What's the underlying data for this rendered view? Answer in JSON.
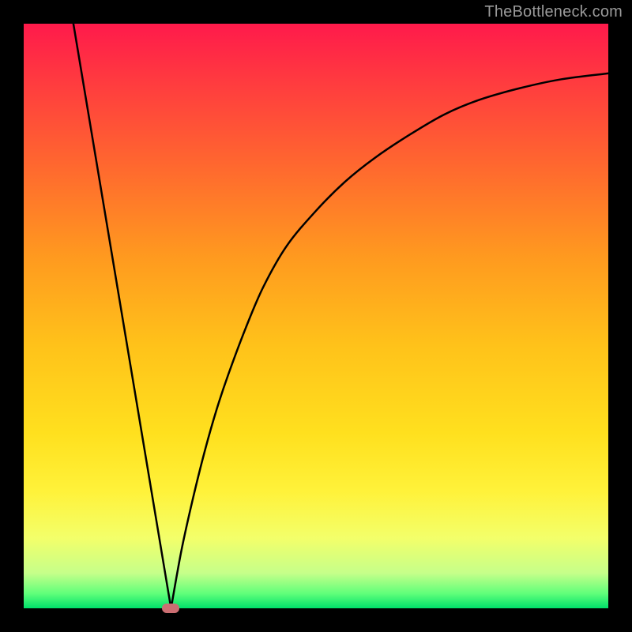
{
  "attribution": "TheBottleneck.com",
  "chart_data": {
    "type": "line",
    "title": "",
    "xlabel": "",
    "ylabel": "",
    "xlim": [
      0,
      100
    ],
    "ylim": [
      0,
      100
    ],
    "gradient_stops": [
      {
        "offset": 0.0,
        "color": "#ff1a4b"
      },
      {
        "offset": 0.1,
        "color": "#ff3b3f"
      },
      {
        "offset": 0.25,
        "color": "#ff6a2e"
      },
      {
        "offset": 0.4,
        "color": "#ff9a1f"
      },
      {
        "offset": 0.55,
        "color": "#ffc21a"
      },
      {
        "offset": 0.7,
        "color": "#ffe01e"
      },
      {
        "offset": 0.8,
        "color": "#fff23a"
      },
      {
        "offset": 0.88,
        "color": "#f3ff6a"
      },
      {
        "offset": 0.94,
        "color": "#c6ff8a"
      },
      {
        "offset": 0.975,
        "color": "#5fff7a"
      },
      {
        "offset": 1.0,
        "color": "#00e06a"
      }
    ],
    "series": [
      {
        "name": "left-line",
        "x": [
          8.5,
          25.2
        ],
        "y": [
          100,
          0
        ]
      },
      {
        "name": "right-curve",
        "x": [
          25.2,
          27,
          29,
          31,
          33,
          35,
          38,
          41,
          45,
          50,
          55,
          60,
          66,
          72,
          78,
          85,
          92,
          100
        ],
        "y": [
          0,
          10,
          19,
          27,
          34,
          40,
          48,
          55,
          62,
          68,
          73,
          77,
          81,
          84.5,
          87,
          89,
          90.5,
          91.5
        ]
      }
    ],
    "marker": {
      "x": 25.2,
      "y": 0,
      "color": "#cc6e72"
    }
  }
}
